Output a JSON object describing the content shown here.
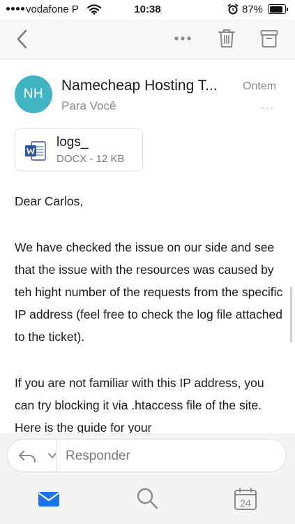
{
  "status_bar": {
    "carrier": "vodafone P",
    "time": "10:38",
    "battery_percent": "87%",
    "battery_level": 0.87,
    "icons": [
      "signal-dots-icon",
      "wifi-icon",
      "alarm-icon",
      "battery-icon"
    ]
  },
  "nav": {
    "icons": [
      "back-chevron-icon",
      "more-dots-icon",
      "trash-icon",
      "archive-icon"
    ]
  },
  "message": {
    "avatar_initials": "NH",
    "sender_name": "Namecheap Hosting T...",
    "recipient": "Para Você",
    "date": "Ontem",
    "more": "···"
  },
  "attachment": {
    "name": "logs_",
    "meta": "DOCX - 12 KB",
    "icon": "word-doc-icon"
  },
  "body": {
    "greeting": "Dear Carlos,",
    "paragraph1": "We have checked the issue on our side and see that the issue with the resources was caused by teh hight number of the requests from the specific IP address (feel free to check the log file attached to the ticket).",
    "paragraph2": "If you are not familiar with this IP address, you can try blocking it via .htaccess file of the site. Here is the guide for your"
  },
  "reply": {
    "placeholder": "Responder",
    "icons": [
      "reply-arrow-icon",
      "chevron-down-icon"
    ]
  },
  "tab_bar": {
    "calendar_day": "24",
    "icons": [
      "mail-icon",
      "search-icon",
      "calendar-icon"
    ]
  },
  "colors": {
    "accent": "#1a73e8",
    "avatar": "#40b4c4"
  }
}
